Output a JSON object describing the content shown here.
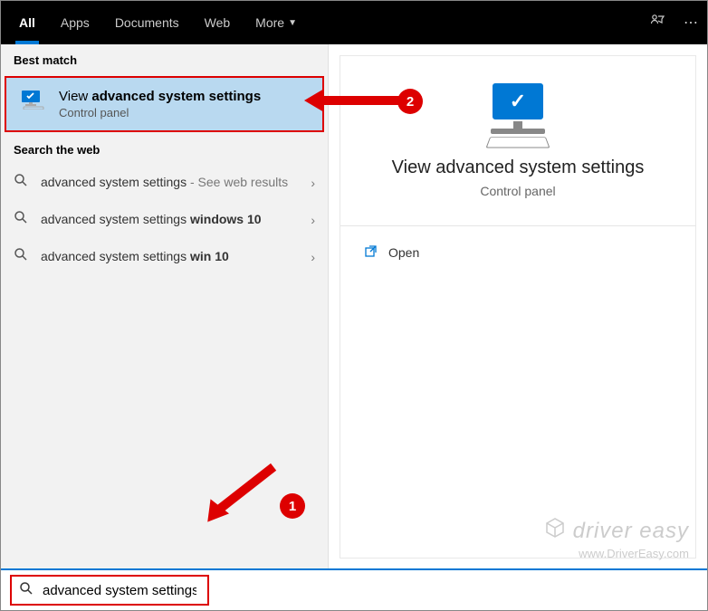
{
  "topbar": {
    "tabs": [
      {
        "label": "All",
        "active": true
      },
      {
        "label": "Apps",
        "active": false
      },
      {
        "label": "Documents",
        "active": false
      },
      {
        "label": "Web",
        "active": false
      },
      {
        "label": "More",
        "active": false,
        "hasDropdown": true
      }
    ]
  },
  "left": {
    "bestMatchHeader": "Best match",
    "bestMatch": {
      "titlePrefix": "View ",
      "titleBold": "advanced system settings",
      "subtitle": "Control panel"
    },
    "webHeader": "Search the web",
    "webResults": [
      {
        "text": "advanced system settings",
        "bold": "",
        "suffix": " - See web results"
      },
      {
        "text": "advanced system settings ",
        "bold": "windows 10",
        "suffix": ""
      },
      {
        "text": "advanced system settings ",
        "bold": "win 10",
        "suffix": ""
      }
    ]
  },
  "right": {
    "title": "View advanced system settings",
    "subtitle": "Control panel",
    "openLabel": "Open"
  },
  "search": {
    "value": "advanced system settings"
  },
  "annotations": {
    "step1": "1",
    "step2": "2"
  },
  "watermark": {
    "brand": "driver easy",
    "url": "www.DriverEasy.com"
  }
}
